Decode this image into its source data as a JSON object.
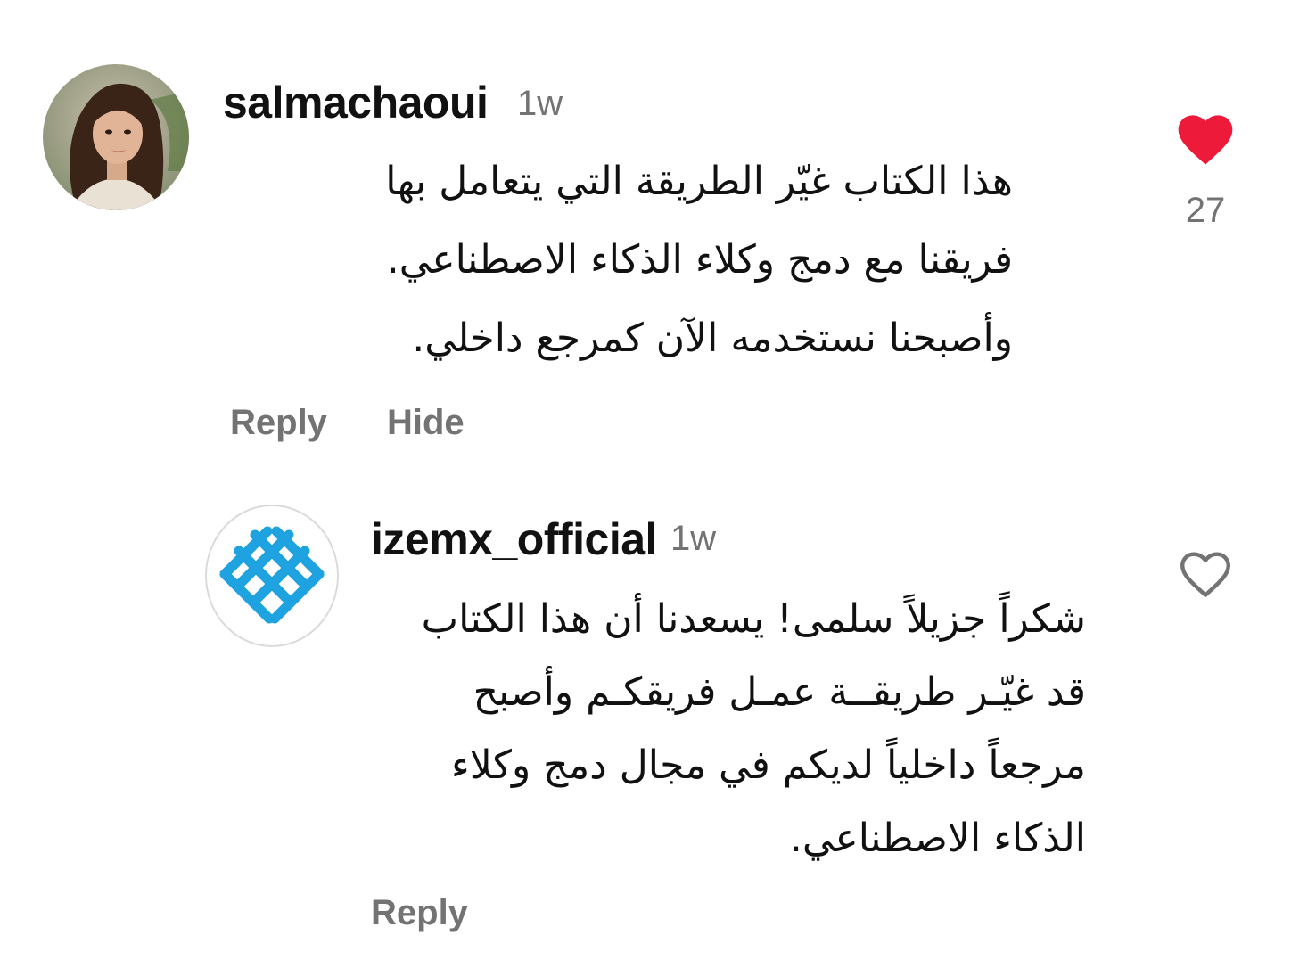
{
  "comments": [
    {
      "username": "salmachaoui",
      "time": "1w",
      "text": "هذا الكتاب غيّر الطريقة التي يتعامل بها\nفريقنا مع دمج وكلاء الذكاء الاصطناعي.\nوأصبحنا نستخدمه الآن كمرجع داخلي.",
      "actions": {
        "reply": "Reply",
        "hide": "Hide"
      },
      "liked": true,
      "like_count": "27",
      "avatar_icon": "profile-photo"
    },
    {
      "username": "izemx_official",
      "time": "1w",
      "text": "شكراً جزيلاً سلمى! يسعدنا أن هذا الكتاب\nقد غيّـر طريقــة عمـل فريقكـم وأصبح\nمرجعاً داخلياً لديكم في مجال دمج وكلاء\nالذكاء الاصطناعي.",
      "actions": {
        "reply": "Reply"
      },
      "liked": false,
      "avatar_icon": "izemx-logo"
    }
  ],
  "colors": {
    "like_red": "#ED1A3A",
    "secondary_text": "#737373",
    "logo_blue": "#1FA3E0"
  }
}
